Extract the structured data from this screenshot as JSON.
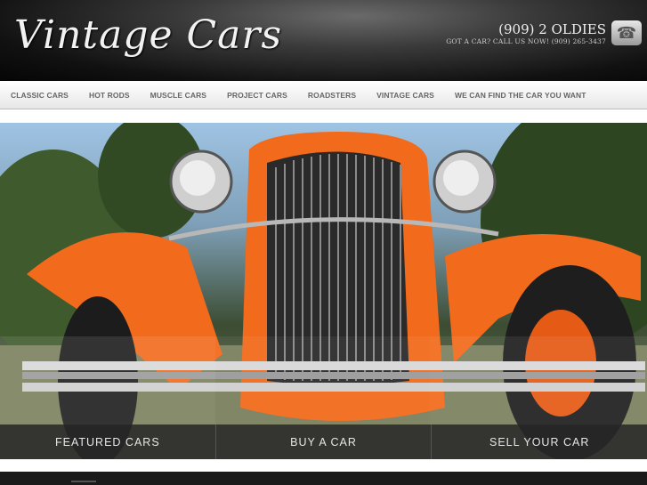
{
  "header": {
    "logo_text": "Vintage Cars",
    "phone_number": "(909) 2 OLDIES",
    "phone_sub": "GOT A CAR? CALL US NOW! (909) 265-3437",
    "phone_icon": "phone-icon"
  },
  "nav": {
    "items": [
      {
        "label": "CLASSIC CARS"
      },
      {
        "label": "HOT RODS"
      },
      {
        "label": "MUSCLE CARS"
      },
      {
        "label": "PROJECT CARS"
      },
      {
        "label": "ROADSTERS"
      },
      {
        "label": "VINTAGE CARS"
      },
      {
        "label": "WE CAN FIND THE CAR YOU WANT"
      }
    ]
  },
  "hero": {
    "buttons": [
      {
        "label": "FEATURED CARS"
      },
      {
        "label": "BUY A CAR"
      },
      {
        "label": "SELL YOUR CAR"
      }
    ]
  },
  "colors": {
    "car_orange": "#f26a1b",
    "nav_text": "#666666",
    "header_dark": "#111111"
  }
}
